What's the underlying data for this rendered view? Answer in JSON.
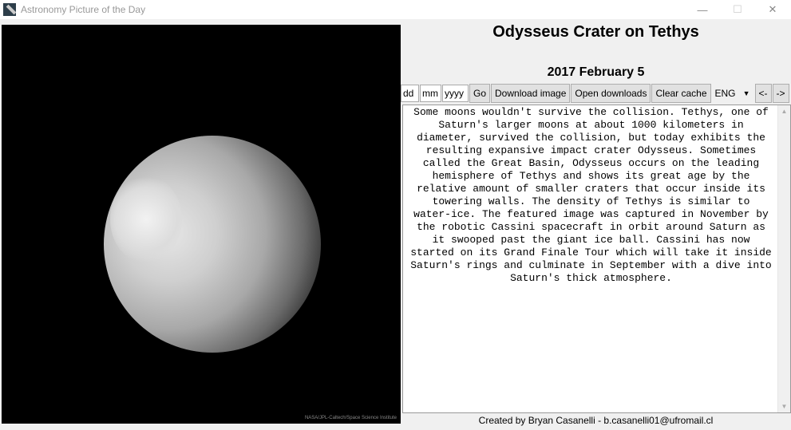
{
  "window": {
    "title": "Astronomy Picture of the Day",
    "minimize": "—",
    "maximize": "☐",
    "close": "✕"
  },
  "image": {
    "credit": "NASA/JPL-Caltech/Space Science Institute"
  },
  "apod": {
    "title": "Odysseus Crater on Tethys",
    "date": "2017 February 5",
    "description_lines": [
      "Some moons wouldn't survive the collision. Tethys, one of",
      "Saturn's larger moons at about 1000 kilometers in",
      "diameter, survived the collision, but today exhibits the",
      "resulting expansive impact crater Odysseus. Sometimes",
      "called the Great Basin, Odysseus occurs on the leading",
      "hemisphere of Tethys and shows its great age by the",
      "relative amount of smaller craters that occur inside its",
      "towering walls. The density of Tethys is similar to",
      "water-ice. The featured image was captured in November by",
      "the robotic Cassini spacecraft in orbit around Saturn as",
      "it swooped past the giant ice ball. Cassini has now",
      "started on its Grand Finale Tour which will take it inside",
      "Saturn's rings and culminate in September with a dive into",
      "Saturn's thick atmosphere."
    ]
  },
  "toolbar": {
    "dd": "dd",
    "mm": "mm",
    "yyyy": "yyyy",
    "go": "Go",
    "download": "Download image",
    "open": "Open downloads",
    "clear": "Clear cache",
    "language": "ENG",
    "prev": "<-",
    "next": "->"
  },
  "footer": "Created by Bryan Casanelli - b.casanelli01@ufromail.cl"
}
